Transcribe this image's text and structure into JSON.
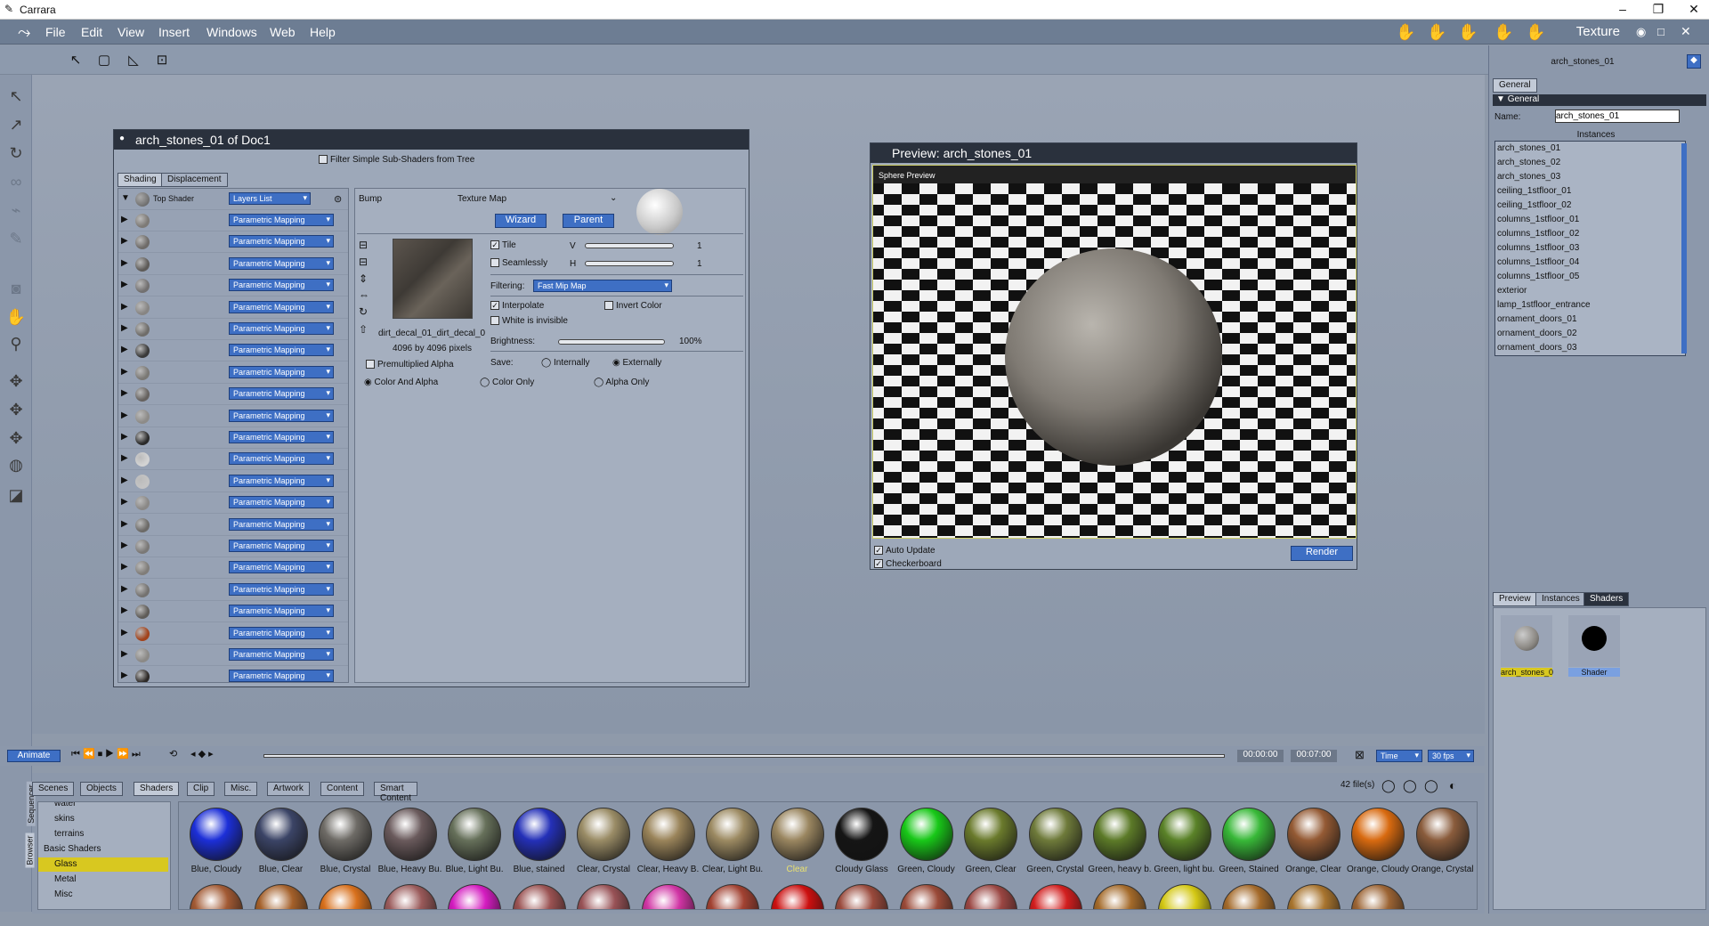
{
  "app": {
    "title": "Carrara",
    "room": "Texture"
  },
  "menu": [
    "File",
    "Edit",
    "View",
    "Insert",
    "Windows",
    "Web",
    "Help"
  ],
  "shader_window": {
    "title": "arch_stones_01 of Doc1",
    "filter_label": "Filter Simple Sub-Shaders from Tree",
    "tabs": [
      "Shading",
      "Displacement"
    ],
    "top_shader": {
      "label": "Top Shader",
      "mode": "Layers List"
    },
    "mapping_label": "Parametric Mapping",
    "editor": {
      "channel": "Bump",
      "type": "Texture Map",
      "wizard": "Wizard",
      "parent": "Parent",
      "tile": "Tile",
      "seamlessly": "Seamlessly",
      "v_label": "V",
      "h_label": "H",
      "v_value": "1",
      "h_value": "1",
      "filtering_label": "Filtering:",
      "filtering_value": "Fast Mip Map",
      "interpolate": "Interpolate",
      "invert": "Invert Color",
      "white_invisible": "White is invisible",
      "brightness_label": "Brightness:",
      "brightness_value": "100%",
      "save_label": "Save:",
      "internally": "Internally",
      "externally": "Externally",
      "filename": "dirt_decal_01_dirt_decal_0",
      "size": "4096 by 4096 pixels",
      "premult": "Premultiplied Alpha",
      "color_alpha": "Color And Alpha",
      "color_only": "Color Only",
      "alpha_only": "Alpha Only"
    }
  },
  "preview": {
    "title": "Preview: arch_stones_01",
    "overlay": "Sphere Preview",
    "auto_update": "Auto Update",
    "checkerboard": "Checkerboard",
    "render": "Render"
  },
  "right_panel": {
    "title": "arch_stones_01",
    "tab": "General",
    "section": "General",
    "name_label": "Name:",
    "name_value": "arch_stones_01",
    "instances_label": "Instances",
    "instances": [
      "arch_stones_01",
      "arch_stones_02",
      "arch_stones_03",
      "ceiling_1stfloor_01",
      "ceiling_1stfloor_02",
      "columns_1stfloor_01",
      "columns_1stfloor_02",
      "columns_1stfloor_03",
      "columns_1stfloor_04",
      "columns_1stfloor_05",
      "exterior",
      "lamp_1stfloor_entrance",
      "ornament_doors_01",
      "ornament_doors_02",
      "ornament_doors_03"
    ],
    "bottom_tabs": [
      "Preview",
      "Instances",
      "Shaders"
    ],
    "shaders": [
      {
        "label": "arch_stones_0",
        "color": "#8a8782"
      },
      {
        "label": "Shader",
        "color": "#000000"
      }
    ]
  },
  "timeline": {
    "animate": "Animate",
    "start": "00:00:00",
    "end": "00:07:00",
    "time": "Time",
    "fps": "30 fps"
  },
  "browser": {
    "tabs": [
      "Scenes",
      "Objects",
      "Shaders",
      "Clip",
      "Misc.",
      "Artwork",
      "Content",
      "Smart Content"
    ],
    "file_count": "42 file(s)",
    "side_labels": [
      "Sequencer",
      "Browser"
    ],
    "tree": [
      "water",
      "skins",
      "terrains",
      "Basic Shaders",
      "Glass",
      "Metal",
      "Misc"
    ],
    "selected_tree": "Glass",
    "swatches": [
      {
        "label": "Blue, Cloudy",
        "color": "#1c2fd8"
      },
      {
        "label": "Blue, Clear",
        "color": "#3b4466"
      },
      {
        "label": "Blue, Crystal",
        "color": "#6e6b66"
      },
      {
        "label": "Blue, Heavy Bu.",
        "color": "#6a5a5c"
      },
      {
        "label": "Blue, Light Bu.",
        "color": "#66705a"
      },
      {
        "label": "Blue, stained",
        "color": "#2430b8"
      },
      {
        "label": "Clear, Crystal",
        "color": "#9a8c66"
      },
      {
        "label": "Clear, Heavy B.",
        "color": "#9a845a"
      },
      {
        "label": "Clear, Light Bu.",
        "color": "#9c8a62"
      },
      {
        "label": "Clear",
        "color": "#9a8660"
      },
      {
        "label": "Cloudy Glass",
        "color": "#151515"
      },
      {
        "label": "Green, Cloudy",
        "color": "#18c818"
      },
      {
        "label": "Green, Clear",
        "color": "#6a7a2c"
      },
      {
        "label": "Green, Crystal",
        "color": "#6e7a3a"
      },
      {
        "label": "Green, heavy b.",
        "color": "#5c7a28"
      },
      {
        "label": "Green, light bu.",
        "color": "#5a8228"
      },
      {
        "label": "Green, Stained",
        "color": "#38b838"
      },
      {
        "label": "Orange, Clear",
        "color": "#945a34"
      },
      {
        "label": "Orange, Cloudy",
        "color": "#d86a10"
      },
      {
        "label": "Orange, Crystal",
        "color": "#8a5c3c"
      }
    ],
    "swatches_row2": [
      "#a25a34",
      "#a4602a",
      "#d8701c",
      "#9a5a5a",
      "#d41cc0",
      "#9a5252",
      "#985256",
      "#d034a4",
      "#a24232",
      "#cc1010",
      "#9a4a3c",
      "#9a4a38",
      "#9a4642",
      "#d21e1e",
      "#a46a2a",
      "#d4c814",
      "#a46a2a",
      "#a8742e",
      "#9c6434"
    ]
  }
}
